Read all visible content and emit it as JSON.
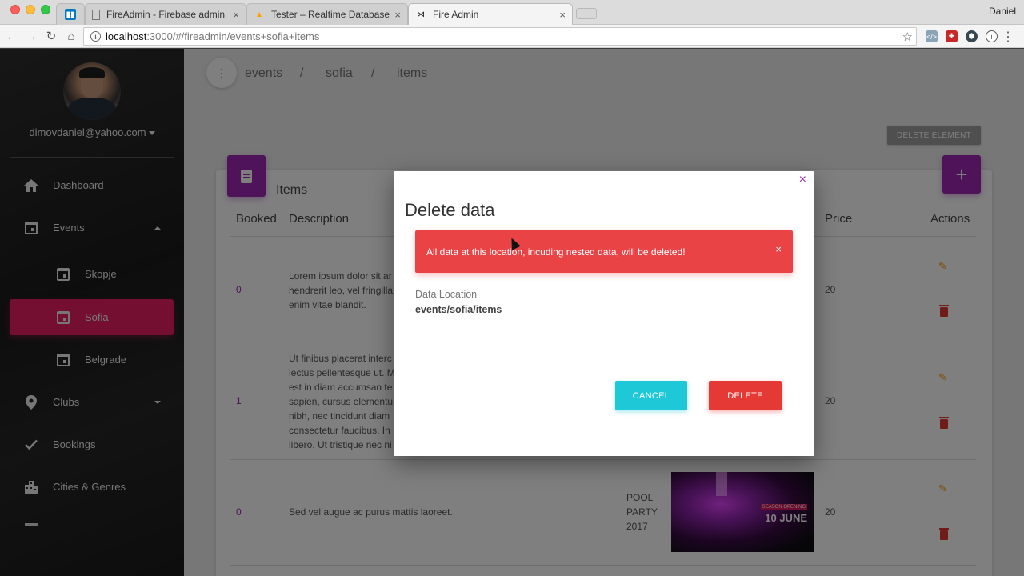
{
  "browser": {
    "tabs": [
      {
        "title": "",
        "icon": "trello-icon",
        "active": false
      },
      {
        "title": "FireAdmin - Firebase admin pa",
        "icon": "page-icon",
        "active": false
      },
      {
        "title": "Tester – Realtime Database – F",
        "icon": "firebase-icon",
        "active": false
      },
      {
        "title": "Fire Admin",
        "icon": "bowtie-icon",
        "active": true
      }
    ],
    "profile_name": "Daniel",
    "url_host": "localhost",
    "url_path": ":3000/#/fireadmin/events+sofia+items",
    "tab_close": "×",
    "star": "☆",
    "menu": "⋮"
  },
  "sidebar": {
    "user_email": "dimovdaniel@yahoo.com",
    "items": [
      {
        "label": "Dashboard",
        "icon": "home-icon"
      },
      {
        "label": "Events",
        "icon": "calendar-icon",
        "expanded": true
      },
      {
        "label": "Skopje",
        "icon": "calendar-icon"
      },
      {
        "label": "Sofia",
        "icon": "calendar-icon",
        "active": true
      },
      {
        "label": "Belgrade",
        "icon": "calendar-icon"
      },
      {
        "label": "Clubs",
        "icon": "location-pin-icon",
        "expanded": false
      },
      {
        "label": "Bookings",
        "icon": "check-icon"
      },
      {
        "label": "Cities & Genres",
        "icon": "city-icon"
      }
    ],
    "active_color": "#e91e63"
  },
  "main": {
    "menu_dots": "⋮",
    "breadcrumb": [
      "events",
      "/",
      "sofia",
      "/",
      "items"
    ],
    "delete_element_label": "DELETE ELEMENT",
    "card_title": "Items",
    "add_label": "+",
    "columns": [
      "Booked",
      "Description",
      "Price",
      "Actions"
    ],
    "rows": [
      {
        "booked": "0",
        "description": "Lorem ipsum dolor sit ar\nhendrerit leo, vel fringilla\nenim vitae blandit.",
        "name": "",
        "price": "20"
      },
      {
        "booked": "1",
        "description": "Ut finibus placerat interc\nlectus pellentesque ut. M\nest in diam accumsan te\nsapien, cursus elementu\nnibh, nec tincidunt diam\nconsectetur faucibus. In\nlibero. Ut tristique nec ni",
        "name": "",
        "price": "20"
      },
      {
        "booked": "0",
        "description": "Sed vel augue ac purus mattis laoreet.",
        "name": "POOL\nPARTY\n2017",
        "price": "20",
        "image_text_1": "SEASON OPENING",
        "image_text_2": "10 JUNE"
      }
    ],
    "accent_color": "#9c27b0"
  },
  "modal": {
    "close": "×",
    "title": "Delete data",
    "alert_text": "All data at this location, incuding nested data, will be deleted!",
    "alert_close": "×",
    "location_label": "Data Location",
    "location_value": "events/sofia/items",
    "cancel_label": "CANCEL",
    "delete_label": "DELETE",
    "alert_color": "#ea4346",
    "cancel_color": "#1fc8d7",
    "delete_color": "#e53935"
  }
}
